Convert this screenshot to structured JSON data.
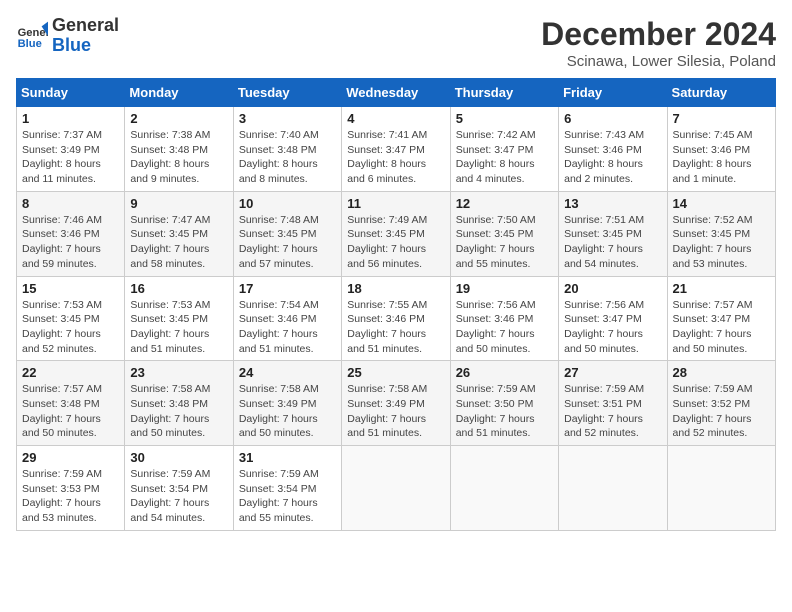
{
  "header": {
    "logo_line1": "General",
    "logo_line2": "Blue",
    "month": "December 2024",
    "location": "Scinawa, Lower Silesia, Poland"
  },
  "weekdays": [
    "Sunday",
    "Monday",
    "Tuesday",
    "Wednesday",
    "Thursday",
    "Friday",
    "Saturday"
  ],
  "weeks": [
    [
      {
        "day": "1",
        "info": "Sunrise: 7:37 AM\nSunset: 3:49 PM\nDaylight: 8 hours and 11 minutes."
      },
      {
        "day": "2",
        "info": "Sunrise: 7:38 AM\nSunset: 3:48 PM\nDaylight: 8 hours and 9 minutes."
      },
      {
        "day": "3",
        "info": "Sunrise: 7:40 AM\nSunset: 3:48 PM\nDaylight: 8 hours and 8 minutes."
      },
      {
        "day": "4",
        "info": "Sunrise: 7:41 AM\nSunset: 3:47 PM\nDaylight: 8 hours and 6 minutes."
      },
      {
        "day": "5",
        "info": "Sunrise: 7:42 AM\nSunset: 3:47 PM\nDaylight: 8 hours and 4 minutes."
      },
      {
        "day": "6",
        "info": "Sunrise: 7:43 AM\nSunset: 3:46 PM\nDaylight: 8 hours and 2 minutes."
      },
      {
        "day": "7",
        "info": "Sunrise: 7:45 AM\nSunset: 3:46 PM\nDaylight: 8 hours and 1 minute."
      }
    ],
    [
      {
        "day": "8",
        "info": "Sunrise: 7:46 AM\nSunset: 3:46 PM\nDaylight: 7 hours and 59 minutes."
      },
      {
        "day": "9",
        "info": "Sunrise: 7:47 AM\nSunset: 3:45 PM\nDaylight: 7 hours and 58 minutes."
      },
      {
        "day": "10",
        "info": "Sunrise: 7:48 AM\nSunset: 3:45 PM\nDaylight: 7 hours and 57 minutes."
      },
      {
        "day": "11",
        "info": "Sunrise: 7:49 AM\nSunset: 3:45 PM\nDaylight: 7 hours and 56 minutes."
      },
      {
        "day": "12",
        "info": "Sunrise: 7:50 AM\nSunset: 3:45 PM\nDaylight: 7 hours and 55 minutes."
      },
      {
        "day": "13",
        "info": "Sunrise: 7:51 AM\nSunset: 3:45 PM\nDaylight: 7 hours and 54 minutes."
      },
      {
        "day": "14",
        "info": "Sunrise: 7:52 AM\nSunset: 3:45 PM\nDaylight: 7 hours and 53 minutes."
      }
    ],
    [
      {
        "day": "15",
        "info": "Sunrise: 7:53 AM\nSunset: 3:45 PM\nDaylight: 7 hours and 52 minutes."
      },
      {
        "day": "16",
        "info": "Sunrise: 7:53 AM\nSunset: 3:45 PM\nDaylight: 7 hours and 51 minutes."
      },
      {
        "day": "17",
        "info": "Sunrise: 7:54 AM\nSunset: 3:46 PM\nDaylight: 7 hours and 51 minutes."
      },
      {
        "day": "18",
        "info": "Sunrise: 7:55 AM\nSunset: 3:46 PM\nDaylight: 7 hours and 51 minutes."
      },
      {
        "day": "19",
        "info": "Sunrise: 7:56 AM\nSunset: 3:46 PM\nDaylight: 7 hours and 50 minutes."
      },
      {
        "day": "20",
        "info": "Sunrise: 7:56 AM\nSunset: 3:47 PM\nDaylight: 7 hours and 50 minutes."
      },
      {
        "day": "21",
        "info": "Sunrise: 7:57 AM\nSunset: 3:47 PM\nDaylight: 7 hours and 50 minutes."
      }
    ],
    [
      {
        "day": "22",
        "info": "Sunrise: 7:57 AM\nSunset: 3:48 PM\nDaylight: 7 hours and 50 minutes."
      },
      {
        "day": "23",
        "info": "Sunrise: 7:58 AM\nSunset: 3:48 PM\nDaylight: 7 hours and 50 minutes."
      },
      {
        "day": "24",
        "info": "Sunrise: 7:58 AM\nSunset: 3:49 PM\nDaylight: 7 hours and 50 minutes."
      },
      {
        "day": "25",
        "info": "Sunrise: 7:58 AM\nSunset: 3:49 PM\nDaylight: 7 hours and 51 minutes."
      },
      {
        "day": "26",
        "info": "Sunrise: 7:59 AM\nSunset: 3:50 PM\nDaylight: 7 hours and 51 minutes."
      },
      {
        "day": "27",
        "info": "Sunrise: 7:59 AM\nSunset: 3:51 PM\nDaylight: 7 hours and 52 minutes."
      },
      {
        "day": "28",
        "info": "Sunrise: 7:59 AM\nSunset: 3:52 PM\nDaylight: 7 hours and 52 minutes."
      }
    ],
    [
      {
        "day": "29",
        "info": "Sunrise: 7:59 AM\nSunset: 3:53 PM\nDaylight: 7 hours and 53 minutes."
      },
      {
        "day": "30",
        "info": "Sunrise: 7:59 AM\nSunset: 3:54 PM\nDaylight: 7 hours and 54 minutes."
      },
      {
        "day": "31",
        "info": "Sunrise: 7:59 AM\nSunset: 3:54 PM\nDaylight: 7 hours and 55 minutes."
      },
      null,
      null,
      null,
      null
    ]
  ]
}
